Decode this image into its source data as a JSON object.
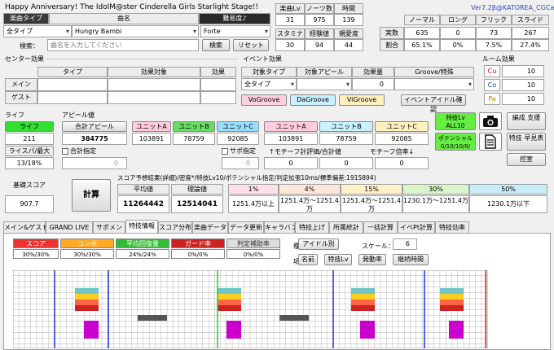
{
  "title": "Happy Anniversary! The IdolM@ster Cinderella Girls Starlight Stage!!",
  "version": "Ver7.2β@KATOREA_CGCalc",
  "song": {
    "type_label": "楽曲タイプ",
    "name_label": "曲名",
    "diff_label": "難易度♪",
    "type_value": "全タイプ",
    "name_value": "Hungry Bambi",
    "diff_value": "Forte",
    "search_label": "検索：",
    "search_placeholder": "曲名を入力してください",
    "search_btn": "検索",
    "reset_btn": "リセット"
  },
  "stats": {
    "lv_label": "楽曲Lv",
    "notes_label": "ノーツ数",
    "time_label": "時間",
    "lv": "31",
    "notes": "975",
    "time": "139",
    "stamina_label": "スタミナ",
    "exp_label": "経験値",
    "fan_label": "親愛度",
    "stamina": "30",
    "exp": "94",
    "fan": "44"
  },
  "notestats": {
    "headers": [
      "ノーマル",
      "ロング",
      "フリック",
      "スライド"
    ],
    "real_label": "実数",
    "ratio_label": "割合",
    "real": [
      "635",
      "0",
      "73",
      "267"
    ],
    "ratio": [
      "65.1%",
      "0%",
      "7.5%",
      "27.4%"
    ]
  },
  "center": {
    "title": "センター効果",
    "type_h": "タイプ",
    "effect_h": "効果対象",
    "eff_h": "効果",
    "main": "メイン",
    "guest": "ゲスト"
  },
  "event": {
    "title": "イベント効果",
    "target_type_h": "対象タイプ",
    "target_appeal_h": "対象アピール",
    "amount_h": "効果量",
    "groove_h": "Groove/特殊",
    "type_value": "全タイプ",
    "amount_value": "0",
    "vo": "VoGroove",
    "da": "DaGroove",
    "vi": "ViGroove",
    "idol_btn": "イベントアイドル確認"
  },
  "room": {
    "title": "ルーム効果",
    "cu": "Cu",
    "co": "Co",
    "pa": "Pa",
    "cu_v": "10",
    "co_v": "10",
    "pa_v": "10"
  },
  "life": {
    "title": "ライフ",
    "life_btn": "ライフ",
    "life_v": "211",
    "ratio_label": "ライスパ/最大",
    "ratio_v": "13/18%"
  },
  "appeal": {
    "title": "アピール値",
    "total_label": "合計アピール",
    "total_v": "384775",
    "sum_label": "合計指定",
    "sum_v": "0",
    "sub_label": "サポ指定",
    "sub_v": "0",
    "units": [
      "ユニットA",
      "ユニットB",
      "ユニットC"
    ],
    "unit_vals": [
      "103891",
      "78759",
      "92085"
    ],
    "units2": [
      "ユニットA",
      "ユニットB",
      "ユニットC"
    ],
    "unit2_vals": [
      "103891",
      "78759",
      "92085"
    ],
    "motif_sum": "↑モチーフ計評価/合計値",
    "motif_ratio": "モチーフ倍率↓",
    "motif_vals": [
      "0",
      "0",
      "0"
    ]
  },
  "side": {
    "special_btn": "特技Lv ALL10",
    "potential_btn": "ポテンシャル 0/10/10/0/",
    "camera": "camera-icon",
    "edit_btn": "編成 支援",
    "list_btn": "特技 早見表",
    "waiting_btn": "控室"
  },
  "score": {
    "base_label": "基礎スコア",
    "base_v": "907.7",
    "calc_btn": "計算",
    "header": "スコア予想結果(詳細)/密度*/特技Lv10/ポテンシャル指定/判定拡張10ms/標準偏差:1915894)",
    "avg_label": "平均値",
    "theory_label": "理論値",
    "avg_v": "11264442",
    "theory_v": "12514041",
    "pct": [
      "1%",
      "4%",
      "15%",
      "30%",
      "50%"
    ],
    "pct_vals": [
      "1251.4万以上",
      "1251.4万〜1251.4万",
      "1251.4万〜1251.4万",
      "1230.1万〜1251.4万",
      "1230.1万以下"
    ]
  },
  "tabs": [
    "メイン&ゲスト",
    "GRAND LIVE",
    "サポメン",
    "特技情報",
    "スコア分布",
    "楽曲データ",
    "データ更新",
    "キャラバン",
    "特技上げ",
    "所属統計",
    "一括計算",
    "イベPt計算",
    "特技効率"
  ],
  "skillinfo": {
    "legend": [
      "スコア",
      "コンボ",
      "平均回復量",
      "ガード率",
      "判定補助率"
    ],
    "legend_vals": [
      "30%/30%",
      "30%/30%",
      "24%/24%",
      "0%/0%",
      "0%/0%"
    ],
    "kind_label": "種別:",
    "kind_btn": "アイドル別",
    "item_label": "項目:",
    "item_btns": [
      "名前",
      "特技Lv",
      "発動率",
      "継続時間"
    ],
    "scale_label": "スケール：",
    "scale_v": "6"
  },
  "colors": {
    "life_green": "#33dd33",
    "unit_a": "#ffccdd",
    "unit_b": "#66dd66",
    "unit_c": "#99ddff",
    "vo": "#ffd0e0",
    "da": "#c8f0ff",
    "vi": "#fff0c0"
  }
}
